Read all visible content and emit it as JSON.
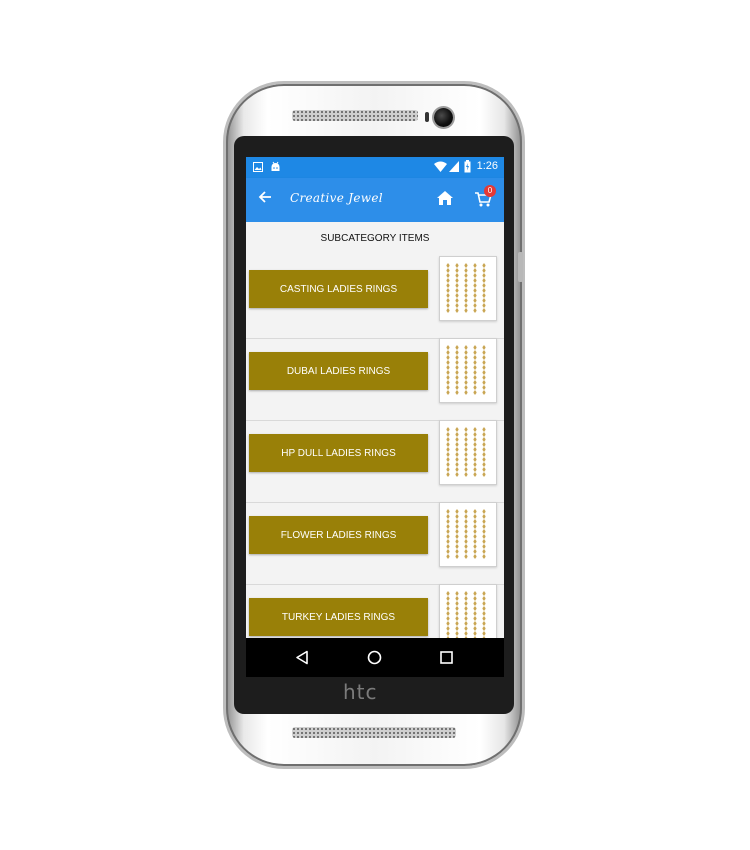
{
  "device": {
    "brand": "htc"
  },
  "status_bar": {
    "time": "1:26"
  },
  "app_bar": {
    "logo_text": "Creative Jewel",
    "cart_count": "0"
  },
  "page": {
    "title": "SUBCATEGORY ITEMS"
  },
  "subcategories": [
    {
      "label": "CASTING LADIES RINGS"
    },
    {
      "label": "DUBAI LADIES RINGS"
    },
    {
      "label": "HP DULL LADIES RINGS"
    },
    {
      "label": "FLOWER LADIES RINGS"
    },
    {
      "label": "TURKEY LADIES RINGS"
    }
  ],
  "colors": {
    "status_bar": "#1e88e5",
    "app_bar": "#2d8ee9",
    "item_button": "#998008",
    "cart_badge": "#e53935"
  },
  "icons": [
    "back-arrow-icon",
    "home-icon",
    "cart-icon",
    "wifi-icon",
    "signal-icon",
    "battery-icon",
    "nav-back-icon",
    "nav-home-icon",
    "nav-recent-icon"
  ]
}
